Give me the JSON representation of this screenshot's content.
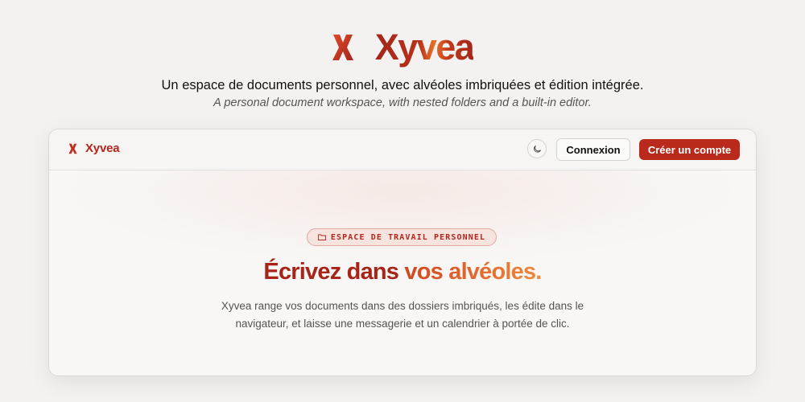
{
  "hero": {
    "brand_name": "Xyvea",
    "tagline_fr": "Un espace de documents personnel, avec alvéoles imbriquées et édition intégrée.",
    "tagline_en": "A personal document workspace, with nested folders and a built-in editor."
  },
  "topbar": {
    "brand_name": "Xyvea",
    "theme_toggle_icon": "moon-icon",
    "login_label": "Connexion",
    "signup_label": "Créer un compte"
  },
  "main": {
    "badge_icon": "folder-icon",
    "badge_label": "ESPACE DE TRAVAIL PERSONNEL",
    "headline_part1": "Écrivez dans ",
    "headline_part2": "vos alvéoles.",
    "description": "Xyvea range vos documents dans des dossiers imbriqués, les édite dans le navigateur, et laisse une messagerie et un calendrier à portée de clic."
  },
  "colors": {
    "brand": "#b3261e",
    "accent": "#e8702a",
    "primary_button": "#b9291c",
    "page_background": "#f3f2f0"
  }
}
